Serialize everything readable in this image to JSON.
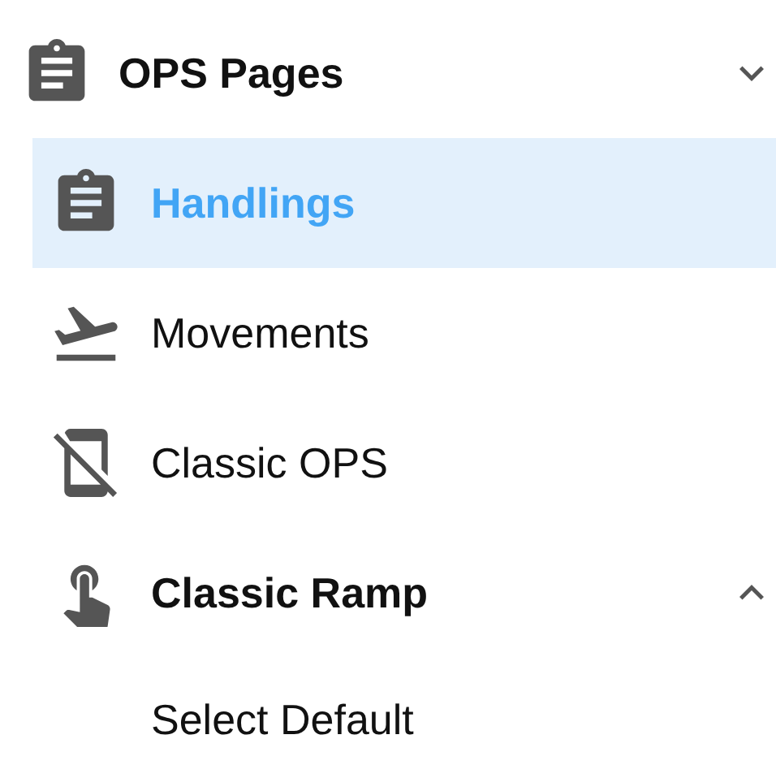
{
  "menu": [
    {
      "label": "OPS Pages",
      "expanded": false,
      "children": [
        {
          "label": "Handlings",
          "selected": true
        },
        {
          "label": "Movements",
          "selected": false
        },
        {
          "label": "Classic OPS",
          "selected": false
        },
        {
          "label": "Classic Ramp",
          "expanded": true,
          "children": [
            {
              "label": "Select Default",
              "selected": false
            }
          ]
        }
      ]
    }
  ]
}
